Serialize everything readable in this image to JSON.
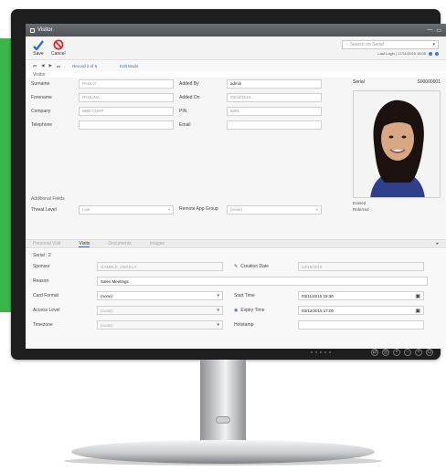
{
  "window": {
    "title": "Visitor",
    "controls": [
      "—",
      "▭"
    ]
  },
  "toolbar": {
    "save_label": "Save",
    "cancel_label": "Cancel",
    "search_placeholder": "Search on Serial",
    "last_login": "Last Login | 17/11/2015 18:08"
  },
  "nav": {
    "record": "Record 2 of 5",
    "mode": "Edit Mode"
  },
  "visitor": {
    "group_label": "Visitor",
    "surname_label": "Surname",
    "surname_value": "PAULO",
    "forename_label": "Forename",
    "forename_value": "PAULINA",
    "company_label": "Company",
    "company_value": "SBD CORP",
    "telephone_label": "Telephone",
    "telephone_value": "",
    "added_by_label": "Added By",
    "added_by_value": "admin",
    "added_on_label": "Added On",
    "added_on_value": "03/10/2015",
    "pin_label": "PIN",
    "pin_value": "5081",
    "email_label": "Email",
    "email_value": ""
  },
  "photo": {
    "serial_label": "Serial",
    "serial_value": "S00000001",
    "status": "Erased",
    "referred": "Referred"
  },
  "additional": {
    "group_label": "Additional Fields",
    "threat_label": "Threat Level",
    "threat_value": "Low",
    "remote_label": "Remote App Group",
    "remote_value": "(none)"
  },
  "tabs": [
    "Personal Visit",
    "Visits",
    "Documents",
    "Images"
  ],
  "details": {
    "serial": "Serial : 2",
    "sponsor_label": "Sponsor",
    "sponsor_value": "GAMBLE, ANGELA",
    "creation_label": "Creation Date",
    "creation_value": "03/10/2015",
    "reason_label": "Reason",
    "reason_value": "Sales Meetings",
    "card_label": "Card Format",
    "card_value": "(none)",
    "start_label": "Start Time",
    "start_value": "03/11/2015 18:30",
    "access_label": "Access Level",
    "access_value": "(none)",
    "expiry_label": "Expiry Time",
    "expiry_value": "03/12/2015 17:00",
    "tz_label": "Timezone",
    "tz_value": "(none)",
    "hotstamp_label": "Hotstamp",
    "hotstamp_value": ""
  },
  "colors": {
    "accent_green": "#3cb54a",
    "link_blue": "#3a6db5",
    "bezel": "#1e1e1e"
  }
}
